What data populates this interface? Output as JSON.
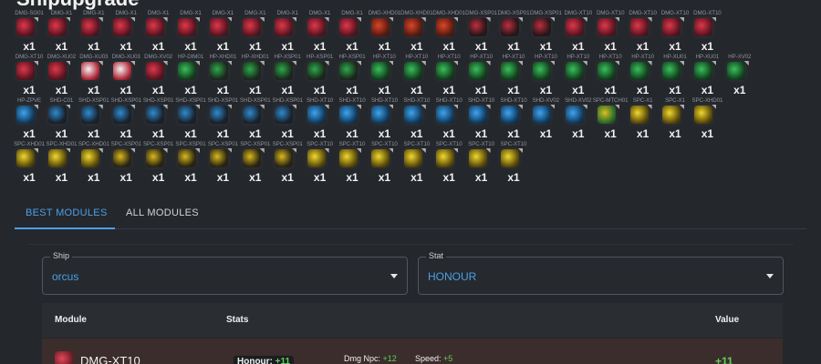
{
  "page": {
    "title": "Shipupgrade"
  },
  "colors": {
    "accent": "#4aa0e8",
    "positive": "#5fcf5f",
    "dmg": "#c8283a",
    "hp": "#2fa84a",
    "shd": "#2a8fd8",
    "spc": "#d8c020"
  },
  "module_rows": [
    {
      "items": [
        {
          "code": "DMG-SG01",
          "count": "x1",
          "kind": "dmg"
        },
        {
          "code": "DMG-X1",
          "count": "x1",
          "kind": "dmg"
        },
        {
          "code": "DMG-X1",
          "count": "x1",
          "kind": "dmg"
        },
        {
          "code": "DMG-X1",
          "count": "x1",
          "kind": "dmg"
        },
        {
          "code": "DMG-X1",
          "count": "x1",
          "kind": "dmg"
        },
        {
          "code": "DMG-X1",
          "count": "x1",
          "kind": "dmg"
        },
        {
          "code": "DMG-X1",
          "count": "x1",
          "kind": "dmg"
        },
        {
          "code": "DMG-X1",
          "count": "x1",
          "kind": "dmg"
        },
        {
          "code": "DMG-X1",
          "count": "x1",
          "kind": "dmg"
        },
        {
          "code": "DMG-X1",
          "count": "x1",
          "kind": "dmg"
        },
        {
          "code": "DMG-X1",
          "count": "x1",
          "kind": "dmg"
        },
        {
          "code": "DMG-XHD01",
          "count": "x1",
          "kind": "dmg-orange"
        },
        {
          "code": "DMG-XHD01",
          "count": "x1",
          "kind": "dmg-orange"
        },
        {
          "code": "DMG-XHD01",
          "count": "x1",
          "kind": "dmg-orange"
        },
        {
          "code": "DMG-XSP01",
          "count": "x1",
          "kind": "dmg-dark"
        },
        {
          "code": "DMG-XSP01",
          "count": "x1",
          "kind": "dmg-dark"
        },
        {
          "code": "DMG-XSP01",
          "count": "x1",
          "kind": "dmg-dark"
        },
        {
          "code": "DMG-XT10",
          "count": "x1",
          "kind": "dmg"
        },
        {
          "code": "DMG-XT10",
          "count": "x1",
          "kind": "dmg"
        },
        {
          "code": "DMG-XT10",
          "count": "x1",
          "kind": "dmg"
        },
        {
          "code": "DMG-XT10",
          "count": "x1",
          "kind": "dmg"
        },
        {
          "code": "DMG-XT10",
          "count": "x1",
          "kind": "dmg"
        }
      ]
    },
    {
      "items": [
        {
          "code": "DMG-XT10",
          "count": "x1",
          "kind": "dmg"
        },
        {
          "code": "DMG-XU02",
          "count": "x1",
          "kind": "dmg"
        },
        {
          "code": "DMG-XU03",
          "count": "x1",
          "kind": "dmg-light"
        },
        {
          "code": "DMG-XU03",
          "count": "x1",
          "kind": "dmg-light"
        },
        {
          "code": "DMG-XV02",
          "count": "x1",
          "kind": "dmg"
        },
        {
          "code": "HP-DIM01",
          "count": "x1",
          "kind": "hp"
        },
        {
          "code": "HP-XHD01",
          "count": "x1",
          "kind": "hp-dark"
        },
        {
          "code": "HP-XHD01",
          "count": "x1",
          "kind": "hp-dark"
        },
        {
          "code": "HP-XSP01",
          "count": "x1",
          "kind": "hp-dark"
        },
        {
          "code": "HP-XSP01",
          "count": "x1",
          "kind": "hp-dark"
        },
        {
          "code": "HP-XSP01",
          "count": "x1",
          "kind": "hp-dark"
        },
        {
          "code": "HP-XT10",
          "count": "x1",
          "kind": "hp"
        },
        {
          "code": "HP-XT10",
          "count": "x1",
          "kind": "hp"
        },
        {
          "code": "HP-XT10",
          "count": "x1",
          "kind": "hp"
        },
        {
          "code": "HP-XT10",
          "count": "x1",
          "kind": "hp"
        },
        {
          "code": "HP-XT10",
          "count": "x1",
          "kind": "hp"
        },
        {
          "code": "HP-XT10",
          "count": "x1",
          "kind": "hp"
        },
        {
          "code": "HP-XT10",
          "count": "x1",
          "kind": "hp"
        },
        {
          "code": "HP-XT10",
          "count": "x1",
          "kind": "hp"
        },
        {
          "code": "HP-XT10",
          "count": "x1",
          "kind": "hp"
        },
        {
          "code": "HP-XU01",
          "count": "x1",
          "kind": "hp"
        },
        {
          "code": "HP-XU01",
          "count": "x1",
          "kind": "hp"
        },
        {
          "code": "HP-XV02",
          "count": "x1",
          "kind": "hp"
        }
      ]
    },
    {
      "items": [
        {
          "code": "HP-ZPVE",
          "count": "x1",
          "kind": "shd"
        },
        {
          "code": "SHD-C01",
          "count": "x1",
          "kind": "shd-dark"
        },
        {
          "code": "SHD-XSP01",
          "count": "x1",
          "kind": "shd-dark"
        },
        {
          "code": "SHD-XSP01",
          "count": "x1",
          "kind": "shd-dark"
        },
        {
          "code": "SHD-XSP01",
          "count": "x1",
          "kind": "shd-dark"
        },
        {
          "code": "SHD-XSP01",
          "count": "x1",
          "kind": "shd-dark"
        },
        {
          "code": "SHD-XSP01",
          "count": "x1",
          "kind": "shd-dark"
        },
        {
          "code": "SHD-XSP01",
          "count": "x1",
          "kind": "shd-dark"
        },
        {
          "code": "SHD-XSP01",
          "count": "x1",
          "kind": "shd-dark"
        },
        {
          "code": "SHD-XT10",
          "count": "x1",
          "kind": "shd"
        },
        {
          "code": "SHD-XT10",
          "count": "x1",
          "kind": "shd"
        },
        {
          "code": "SHD-XT10",
          "count": "x1",
          "kind": "shd"
        },
        {
          "code": "SHD-XT10",
          "count": "x1",
          "kind": "shd"
        },
        {
          "code": "SHD-XT10",
          "count": "x1",
          "kind": "shd"
        },
        {
          "code": "SHD-XT10",
          "count": "x1",
          "kind": "shd"
        },
        {
          "code": "SHD-XT10",
          "count": "x1",
          "kind": "shd"
        },
        {
          "code": "SHD-XV02",
          "count": "x1",
          "kind": "shd"
        },
        {
          "code": "SHD-XV02",
          "count": "x1",
          "kind": "shd"
        },
        {
          "code": "SPC-MTCH01",
          "count": "x1",
          "kind": "spc-mix"
        },
        {
          "code": "SPC-X1",
          "count": "x1",
          "kind": "spc"
        },
        {
          "code": "SPC-X1",
          "count": "x1",
          "kind": "spc"
        },
        {
          "code": "SPC-XHD01",
          "count": "x1",
          "kind": "spc"
        }
      ]
    },
    {
      "items": [
        {
          "code": "SPC-XHD01",
          "count": "x1",
          "kind": "spc"
        },
        {
          "code": "SPC-XHD01",
          "count": "x1",
          "kind": "spc"
        },
        {
          "code": "SPC-XHD01",
          "count": "x1",
          "kind": "spc"
        },
        {
          "code": "SPC-XSP01",
          "count": "x1",
          "kind": "spc-dark"
        },
        {
          "code": "SPC-XSP01",
          "count": "x1",
          "kind": "spc-dark"
        },
        {
          "code": "SPC-XSP01",
          "count": "x1",
          "kind": "spc-dark"
        },
        {
          "code": "SPC-XSP01",
          "count": "x1",
          "kind": "spc-dark"
        },
        {
          "code": "SPC-XSP01",
          "count": "x1",
          "kind": "spc-dark"
        },
        {
          "code": "SPC-XSP01",
          "count": "x1",
          "kind": "spc-dark"
        },
        {
          "code": "SPC-XT10",
          "count": "x1",
          "kind": "spc"
        },
        {
          "code": "SPC-XT10",
          "count": "x1",
          "kind": "spc"
        },
        {
          "code": "SPC-XT10",
          "count": "x1",
          "kind": "spc"
        },
        {
          "code": "SPC-XT10",
          "count": "x1",
          "kind": "spc"
        },
        {
          "code": "SPC-XT10",
          "count": "x1",
          "kind": "spc"
        },
        {
          "code": "SPC-XT10",
          "count": "x1",
          "kind": "spc"
        },
        {
          "code": "SPC-XT10",
          "count": "x1",
          "kind": "spc"
        }
      ]
    }
  ],
  "tabs": [
    {
      "label": "BEST MODULES",
      "active": true
    },
    {
      "label": "ALL MODULES",
      "active": false
    }
  ],
  "filters": {
    "ship": {
      "label": "Ship",
      "value": "orcus"
    },
    "stat": {
      "label": "Stat",
      "value": "HONOUR"
    }
  },
  "table": {
    "headers": {
      "module": "Module",
      "stats": "Stats",
      "value": "Value"
    },
    "rows": [
      {
        "module": "DMG-XT10",
        "main_stat_label": "Honour:",
        "main_stat_value": "+11",
        "extra_stats": [
          {
            "label": "Dmg Npc:",
            "value": "+12"
          },
          {
            "label": "Speed:",
            "value": "+5"
          }
        ],
        "value": "+11"
      }
    ]
  }
}
